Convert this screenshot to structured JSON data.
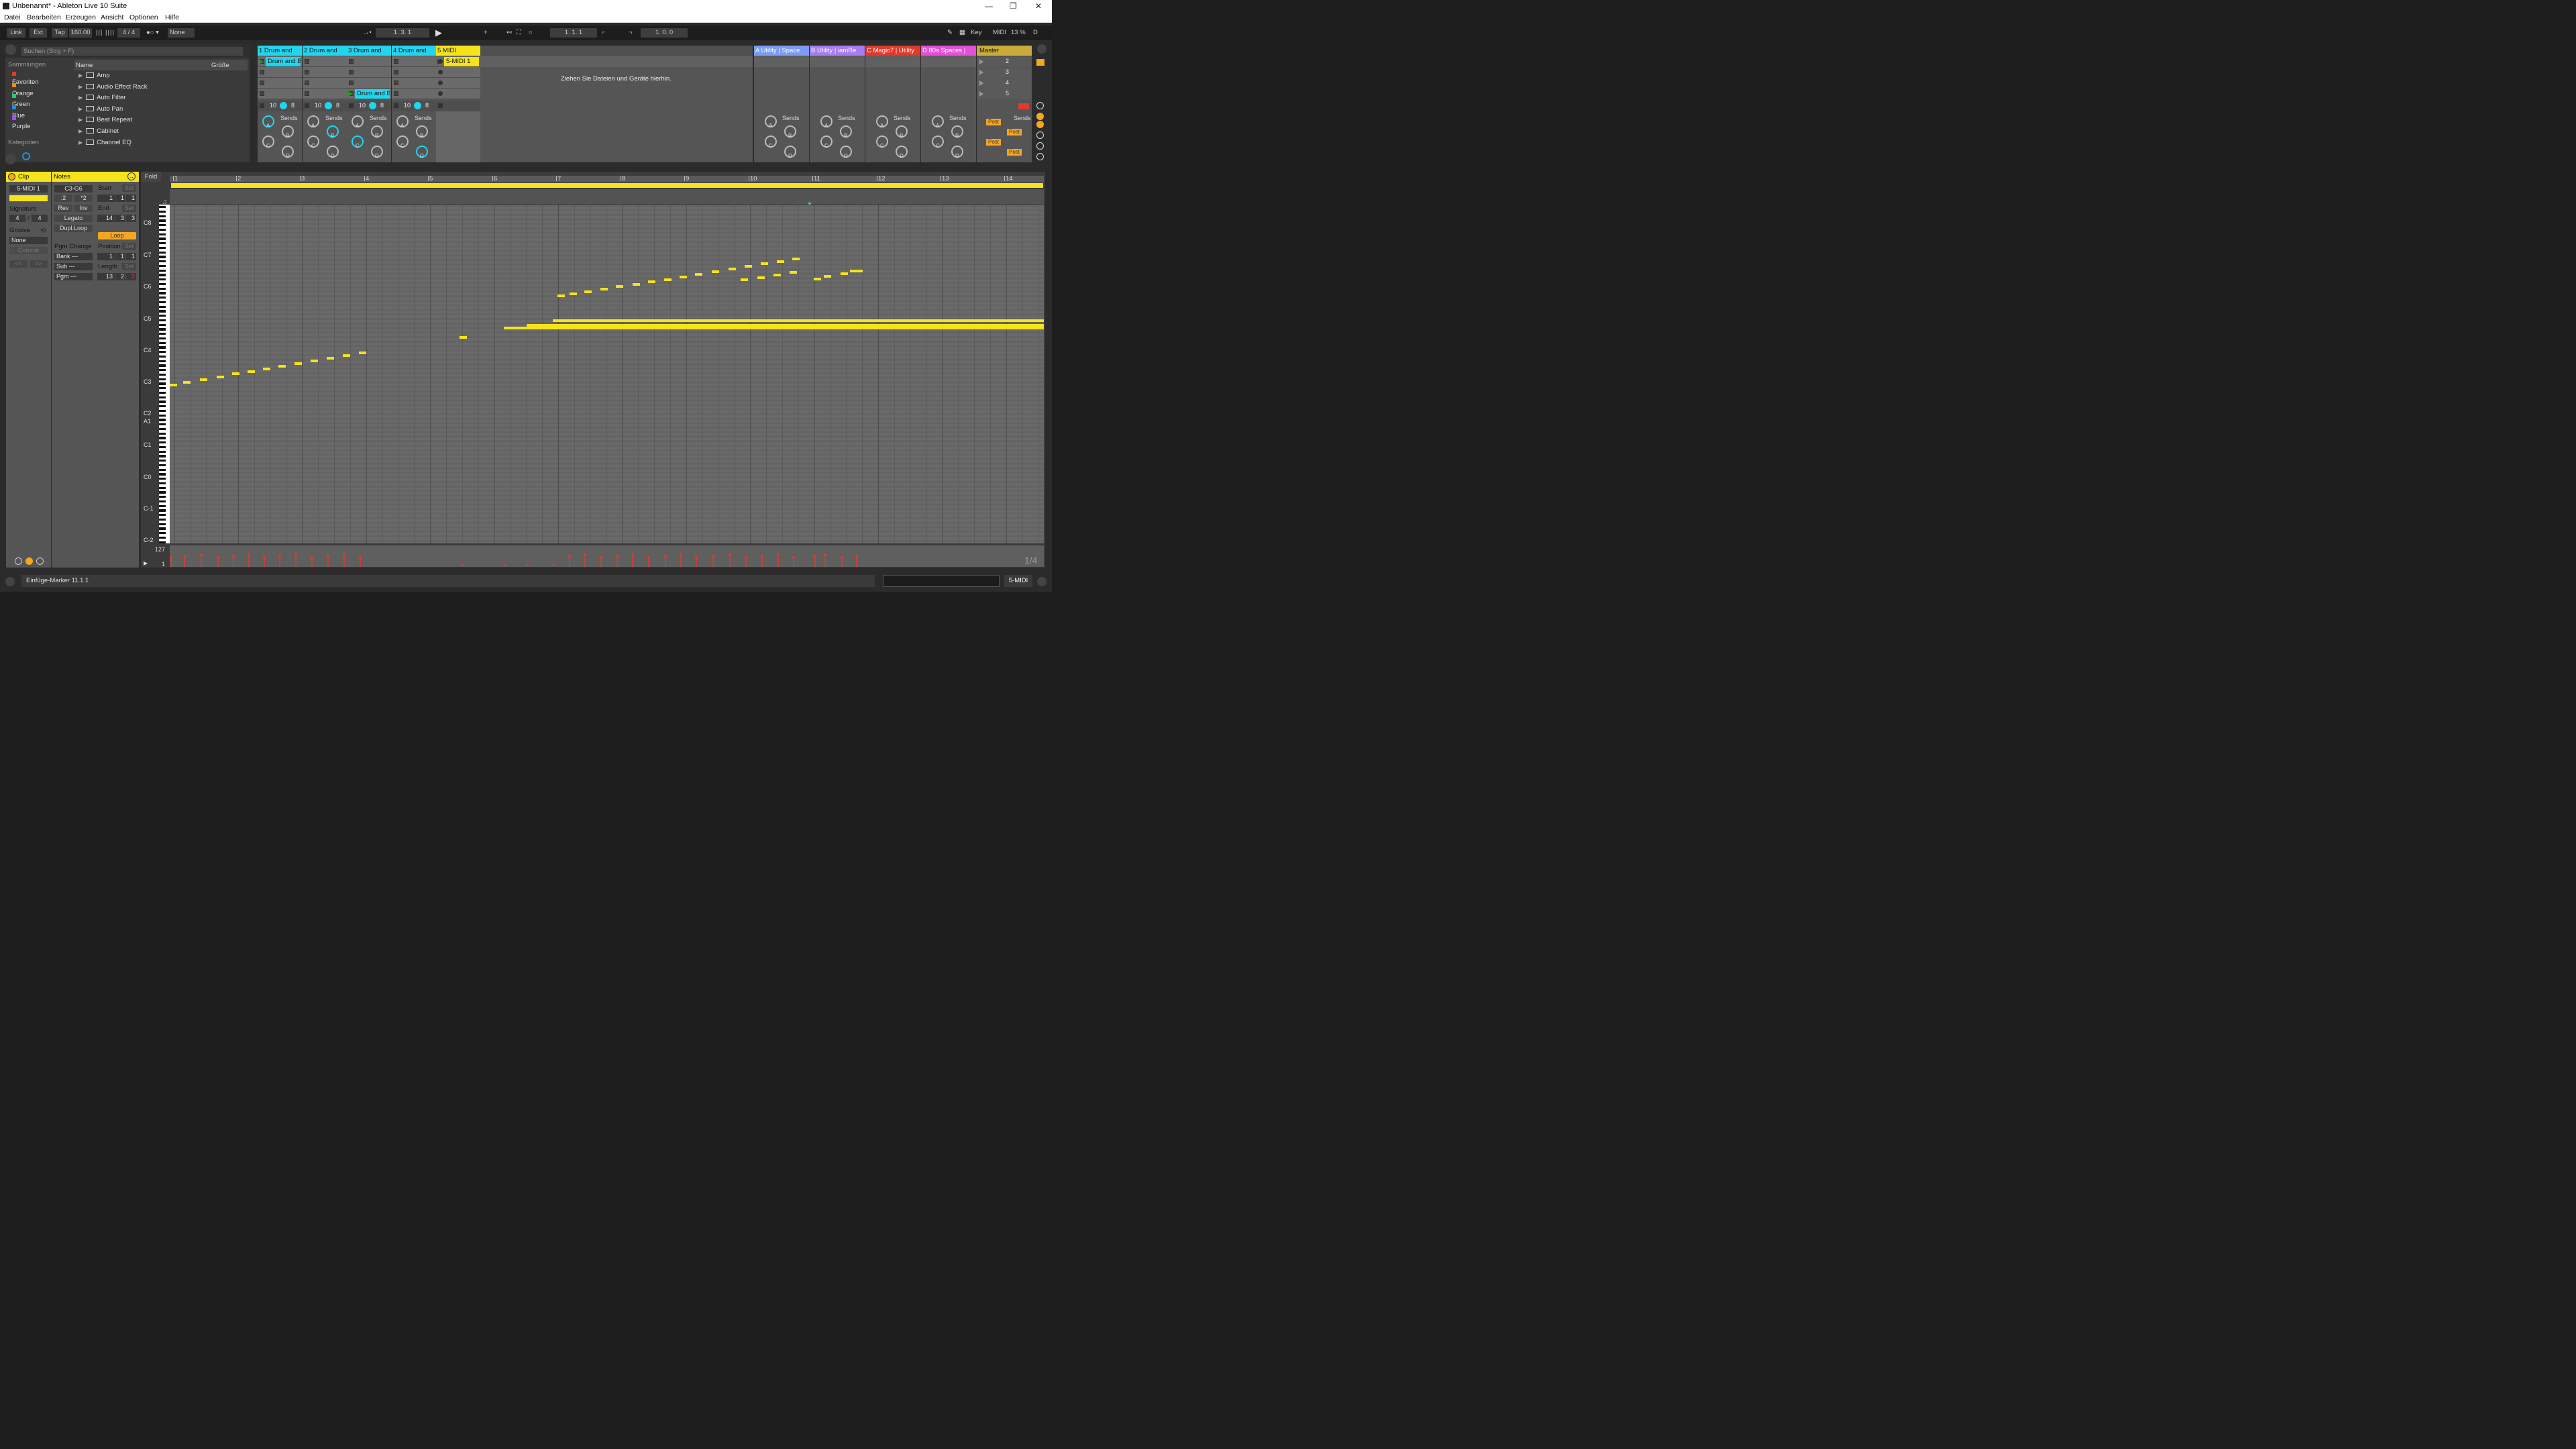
{
  "window": {
    "title": "Unbenannt* - Ableton Live 10 Suite"
  },
  "menu": [
    "Datei",
    "Bearbeiten",
    "Erzeugen",
    "Ansicht",
    "Optionen",
    "Hilfe"
  ],
  "transport": {
    "link": "Link",
    "ext": "Ext",
    "tap": "Tap",
    "tempo": "160.00",
    "signature": "4 / 4",
    "quantize": "None",
    "arrangement_position": "1.  3.  1",
    "loop_start": "1.  1.  1",
    "loop_length": "1.  0.  0",
    "key": "Key",
    "midi": "MIDI",
    "cpu": "13 %",
    "d": "D"
  },
  "browser": {
    "search_placeholder": "Suchen (Strg + F)",
    "sammlungen_label": "Sammlungen",
    "kategorien_label": "Kategorien",
    "col_name": "Name",
    "col_size": "Größe",
    "collections": [
      {
        "label": "Favoriten",
        "color": "#e23a2c"
      },
      {
        "label": "Orange",
        "color": "#f08a1c"
      },
      {
        "label": "Green",
        "color": "#2cc76a"
      },
      {
        "label": "Blue",
        "color": "#1f8fe0"
      },
      {
        "label": "Purple",
        "color": "#9a54e4"
      }
    ],
    "items": [
      "Amp",
      "Audio Effect Rack",
      "Auto Filter",
      "Auto Pan",
      "Beat Repeat",
      "Cabinet",
      "Channel EQ"
    ]
  },
  "tracks": [
    {
      "name": "1 Drum and",
      "clip": "Drum and B",
      "vol": "10",
      "pan": "8"
    },
    {
      "name": "2 Drum and",
      "clip": "Drum and B",
      "vol": "10",
      "pan": "8"
    },
    {
      "name": "3 Drum and",
      "clip": "Drum and B",
      "vol": "10",
      "pan": "8"
    },
    {
      "name": "4 Drum and",
      "clip": "",
      "vol": "10",
      "pan": "8"
    },
    {
      "name": "5 MIDI",
      "clip": "5-MIDI 1",
      "vol": "",
      "pan": ""
    }
  ],
  "drop_hint": "Ziehen Sie Dateien und Geräte hierhin.",
  "returns": [
    {
      "name": "A Utility | Space",
      "color": "#7c9cf0"
    },
    {
      "name": "B Utility | iamRe",
      "color": "#a77cf0"
    },
    {
      "name": "C Magic7 | Utility",
      "color": "#e03a2c"
    },
    {
      "name": "D 80s Spaces |",
      "color": "#e34fd7"
    }
  ],
  "master": {
    "name": "Master",
    "scenes": [
      "2",
      "3",
      "4",
      "5"
    ],
    "post": "Post"
  },
  "sends_label": "Sends",
  "send_letters": [
    "A",
    "B",
    "C",
    "D"
  ],
  "clip_panel": {
    "header": "Clip",
    "name": "5-MIDI 1",
    "signature_label": "Signature",
    "sig_num": "4",
    "sig_den": "4",
    "groove_label": "Groove",
    "groove_value": "None",
    "commit": "Commit"
  },
  "notes_panel": {
    "header": "Notes",
    "range": "C3-G6",
    "half": ":2",
    "double": "*2",
    "rev": "Rev",
    "inv": "Inv",
    "legato": "Legato",
    "dupl": "Dupl.Loop",
    "start_label": "Start",
    "start": [
      "1",
      "1",
      "1"
    ],
    "end_label": "End",
    "end": [
      "14",
      "3",
      "3"
    ],
    "loop": "Loop",
    "position_label": "Position",
    "position": [
      "1",
      "1",
      "1"
    ],
    "length_label": "Length",
    "length": [
      "13",
      "2",
      "2"
    ],
    "pgm_change": "Pgm Change",
    "bank": "Bank ---",
    "sub": "Sub ---",
    "pgm": "Pgm ---",
    "set": "Set"
  },
  "editor": {
    "fold": "Fold",
    "bars": [
      "1",
      "2",
      "3",
      "4",
      "5",
      "6",
      "7",
      "8",
      "9",
      "10",
      "11",
      "12",
      "13",
      "14"
    ],
    "keys": [
      "C8",
      "C7",
      "C6",
      "C5",
      "C4",
      "C3",
      "C2",
      "A1",
      "C1",
      "C0",
      "C-1",
      "C-2"
    ],
    "vel_max": "127",
    "vel_min": "1",
    "grid": "1/4"
  },
  "status": {
    "text": "Einfüge-Marker 11.1.1",
    "track": "5-MIDI"
  },
  "colors": {
    "accent": "#f5e31b",
    "clip_cyan": "#22d5ef",
    "orange": "#f5a623"
  }
}
